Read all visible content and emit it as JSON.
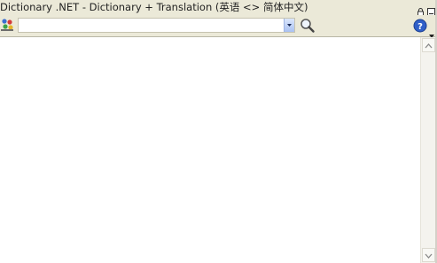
{
  "window": {
    "title": "Dictionary .NET - Dictionary + Translation (英语 <> 简体中文)"
  },
  "titlebar": {
    "buttons": [
      {
        "icon": "lock-icon"
      },
      {
        "icon": "minimize-icon"
      }
    ]
  },
  "toolbar": {
    "logo_icon": "dictionary-logo-icon",
    "search": {
      "value": "",
      "placeholder": ""
    },
    "search_button_icon": "magnifier-icon",
    "help_icon": "help-icon"
  },
  "colors": {
    "chrome": "#ebe9d8",
    "dropdown_accent": "#a9c1f2",
    "help_blue": "#2f5fc8"
  }
}
